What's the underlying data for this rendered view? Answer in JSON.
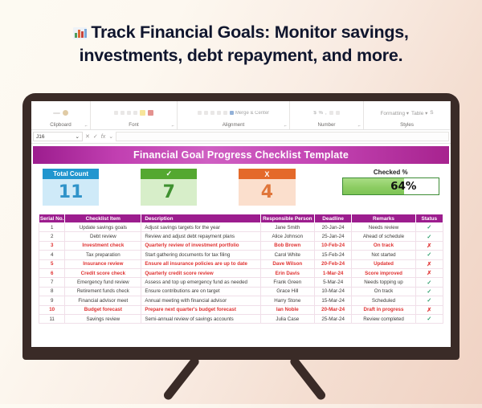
{
  "headline": {
    "icon": "bar-chart-icon",
    "text": "Track Financial Goals: Monitor savings, investments, debt repayment, and more."
  },
  "ribbon": {
    "groups": [
      {
        "label": "Clipboard"
      },
      {
        "label": "Font"
      },
      {
        "label": "Alignment",
        "merge_label": "Merge & Center"
      },
      {
        "label": "Number"
      },
      {
        "label": "Styles",
        "commands": [
          "Formatting",
          "Table",
          "S"
        ]
      }
    ]
  },
  "formula_bar": {
    "name_box": "J16",
    "cancel_icon": "close-icon",
    "confirm_icon": "check-icon",
    "function_icon": "fx-icon",
    "value": ""
  },
  "sheet": {
    "title": "Financial Goal Progress Checklist Template",
    "kpis": [
      {
        "name": "total-count",
        "label": "Total Count",
        "value": "11",
        "color": "#2196cf"
      },
      {
        "name": "checked-count",
        "label": "✓",
        "value": "7",
        "color": "#54a830"
      },
      {
        "name": "unchecked-count",
        "label": "X",
        "value": "4",
        "color": "#e4692a"
      }
    ],
    "gauge": {
      "label": "Checked %",
      "value": "64%",
      "percent": 64,
      "color": "#8dcd63"
    },
    "table": {
      "headers": [
        "Serial No.",
        "Checklist Item",
        "Description",
        "Responsible Person",
        "Deadline",
        "Remarks",
        "Status"
      ],
      "rows": [
        {
          "serial": "1",
          "item": "Update savings goals",
          "desc": "Adjust savings targets for the year",
          "person": "Jane Smith",
          "deadline": "20-Jan-24",
          "remarks": "Needs review",
          "status": "✓",
          "alert": false
        },
        {
          "serial": "2",
          "item": "Debt review",
          "desc": "Review and adjust debt repayment plans",
          "person": "Alice Johnson",
          "deadline": "25-Jan-24",
          "remarks": "Ahead of schedule",
          "status": "✓",
          "alert": false
        },
        {
          "serial": "3",
          "item": "Investment check",
          "desc": "Quarterly review of investment portfolio",
          "person": "Bob Brown",
          "deadline": "10-Feb-24",
          "remarks": "On track",
          "status": "✗",
          "alert": true
        },
        {
          "serial": "4",
          "item": "Tax preparation",
          "desc": "Start gathering documents for tax filing",
          "person": "Carol White",
          "deadline": "15-Feb-24",
          "remarks": "Not started",
          "status": "✓",
          "alert": false
        },
        {
          "serial": "5",
          "item": "Insurance review",
          "desc": "Ensure all insurance policies are up to date",
          "person": "Dave Wilson",
          "deadline": "20-Feb-24",
          "remarks": "Updated",
          "status": "✗",
          "alert": true
        },
        {
          "serial": "6",
          "item": "Credit score check",
          "desc": "Quarterly credit score review",
          "person": "Erin Davis",
          "deadline": "1-Mar-24",
          "remarks": "Score improved",
          "status": "✗",
          "alert": true
        },
        {
          "serial": "7",
          "item": "Emergency fund review",
          "desc": "Assess and top up emergency fund as needed",
          "person": "Frank Green",
          "deadline": "5-Mar-24",
          "remarks": "Needs topping up",
          "status": "✓",
          "alert": false
        },
        {
          "serial": "8",
          "item": "Retirement funds check",
          "desc": "Ensure contributions are on target",
          "person": "Grace Hill",
          "deadline": "10-Mar-24",
          "remarks": "On track",
          "status": "✓",
          "alert": false
        },
        {
          "serial": "9",
          "item": "Financial advisor meet",
          "desc": "Annual meeting with financial advisor",
          "person": "Harry Stone",
          "deadline": "15-Mar-24",
          "remarks": "Scheduled",
          "status": "✓",
          "alert": false
        },
        {
          "serial": "10",
          "item": "Budget forecast",
          "desc": "Prepare next quarter's budget forecast",
          "person": "Ian Noble",
          "deadline": "20-Mar-24",
          "remarks": "Draft in progress",
          "status": "✗",
          "alert": true
        },
        {
          "serial": "11",
          "item": "Savings review",
          "desc": "Semi-annual review of savings accounts",
          "person": "Julia Case",
          "deadline": "25-Mar-24",
          "remarks": "Review completed",
          "status": "✓",
          "alert": false
        }
      ]
    }
  }
}
